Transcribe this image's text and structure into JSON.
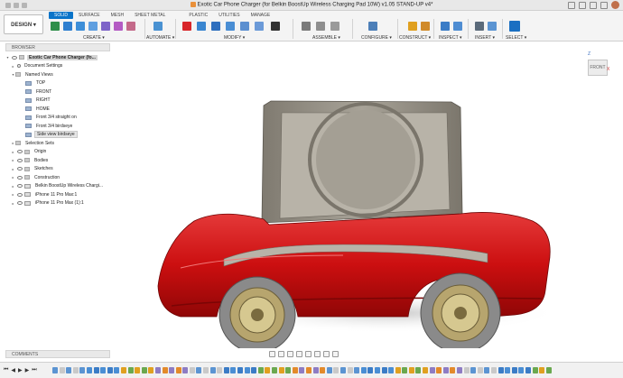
{
  "window": {
    "title": "Exotic Car Phone Charger (for Belkin BoostUp Wireless Charging Pad 10W) v1.05 STAND-UP v4*"
  },
  "toolbar": {
    "workspace_button": "DESIGN ▾",
    "tabs": [
      {
        "label": "SOLID",
        "active": true
      },
      {
        "label": "SURFACE",
        "active": false
      },
      {
        "label": "MESH",
        "active": false
      },
      {
        "label": "SHEET METAL",
        "active": false
      },
      {
        "label": "PLASTIC",
        "active": false
      },
      {
        "label": "UTILITIES",
        "active": false
      },
      {
        "label": "MANAGE",
        "active": false
      }
    ],
    "groups": {
      "create": "CREATE ▾",
      "automate": "AUTOMATE ▾",
      "modify": "MODIFY ▾",
      "assemble": "ASSEMBLE ▾",
      "configure": "CONFIGURE ▾",
      "construct": "CONSTRUCT ▾",
      "inspect": "INSPECT ▾",
      "insert": "INSERT ▾",
      "select": "SELECT ▾"
    },
    "accent_color": "#0a74c9"
  },
  "browser": {
    "header": "BROWSER",
    "root": "Exotic Car Phone Charger (fo...",
    "document_settings": "Document Settings",
    "named_views": "Named Views",
    "views": [
      "TOP",
      "FRONT",
      "RIGHT",
      "HOME",
      "Front 3/4 straight on",
      "Front 3/4 birdseye",
      "Side view birdseye"
    ],
    "selection_sets": "Selection Sets",
    "folders": [
      "Origin",
      "Bodies",
      "Sketches",
      "Construction"
    ],
    "components": [
      "Belkin BoostUp Wireless Chargi...",
      "iPhone 11 Pro Max:1",
      "iPhone 11 Pro Max (1):1"
    ]
  },
  "viewcube": {
    "face": "FRONT",
    "z": "Z",
    "x": "X"
  },
  "comments": {
    "header": "COMMENTS"
  },
  "model": {
    "body_color": "#d40f0f",
    "stand_color": "#8f8a80",
    "rim_color": "#b7a56e"
  },
  "playback": {
    "controls": [
      "⏮",
      "◀",
      "▶",
      "▶",
      "⏭"
    ]
  }
}
